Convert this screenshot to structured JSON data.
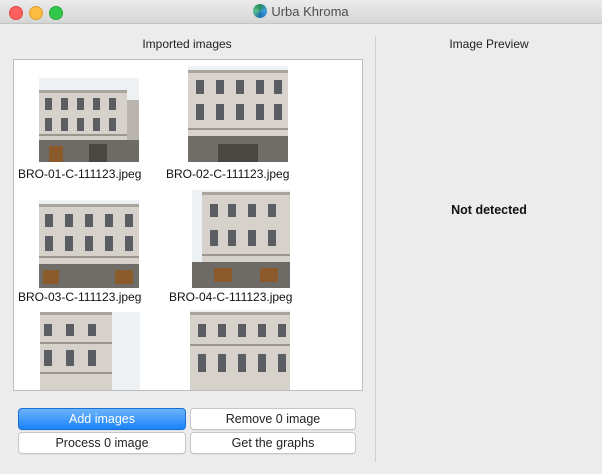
{
  "window": {
    "title": "Urba Khroma"
  },
  "left_panel": {
    "heading": "Imported images",
    "thumbnails": [
      {
        "label": "BRO-01-C-111123.jpeg"
      },
      {
        "label": "BRO-02-C-111123.jpeg"
      },
      {
        "label": "BRO-03-C-111123.jpeg"
      },
      {
        "label": "BRO-04-C-111123.jpeg"
      },
      {
        "label": ""
      },
      {
        "label": ""
      }
    ]
  },
  "right_panel": {
    "heading": "Image Preview",
    "status": "Not detected"
  },
  "buttons": {
    "add": "Add images",
    "remove": "Remove 0 image",
    "process": "Process 0 image",
    "graphs": "Get the graphs"
  },
  "colors": {
    "accent": "#1a82fb",
    "sky": "#e8ecef",
    "facade": "#d3cfc8"
  }
}
